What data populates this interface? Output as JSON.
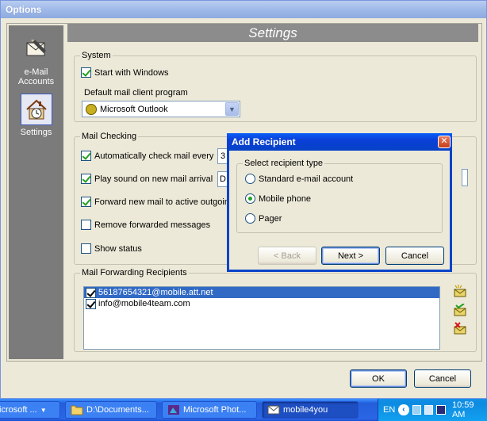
{
  "window": {
    "title": "Options"
  },
  "nav": {
    "items": [
      {
        "label_lines": [
          "e-Mail",
          "Accounts"
        ],
        "icon": "email-accounts-icon",
        "selected": false
      },
      {
        "label_lines": [
          "Settings"
        ],
        "icon": "settings-house-icon",
        "selected": true
      }
    ]
  },
  "header": {
    "title": "Settings"
  },
  "system": {
    "legend": "System",
    "start_with_windows": {
      "label": "Start with Windows",
      "checked": true
    },
    "default_mail_label": "Default mail client program",
    "mail_client": {
      "value": "Microsoft Outlook",
      "icon": "outlook-icon"
    }
  },
  "mail_checking": {
    "legend": "Mail Checking",
    "auto_check": {
      "label": "Automatically check mail every",
      "checked": true,
      "value": "3"
    },
    "play_sound": {
      "label": "Play sound on new mail arrival",
      "checked": true,
      "value": "D:"
    },
    "forward_new": {
      "label": "Forward new mail to active outgoing",
      "checked": true
    },
    "remove_forwarded": {
      "label": "Remove forwarded messages",
      "checked": false
    },
    "show_status": {
      "label": "Show status",
      "checked": false
    }
  },
  "forwarding": {
    "legend": "Mail Forwarding Recipients",
    "recipients": [
      {
        "text": "56187654321@mobile.att.net",
        "checked": true,
        "selected": true
      },
      {
        "text": "info@mobile4team.com",
        "checked": true,
        "selected": false
      }
    ],
    "side_icons": [
      "add-recipient-icon",
      "edit-recipient-icon",
      "delete-recipient-icon"
    ]
  },
  "footer": {
    "ok": "OK",
    "cancel": "Cancel"
  },
  "dialog": {
    "title": "Add Recipient",
    "legend": "Select recipient type",
    "options": [
      {
        "label": "Standard e-mail account",
        "checked": false
      },
      {
        "label": "Mobile phone",
        "checked": true
      },
      {
        "label": "Pager",
        "checked": false
      }
    ],
    "back": "< Back",
    "next": "Next >",
    "cancel": "Cancel"
  },
  "taskbar": {
    "tasks": [
      {
        "label": "icrosoft ...",
        "icon": "dropdown-arrow-icon",
        "active": false
      },
      {
        "label": "D:\\Documents...",
        "icon": "folder-icon",
        "active": false
      },
      {
        "label": "Microsoft Phot...",
        "icon": "photo-editor-icon",
        "active": false
      },
      {
        "label": "mobile4you",
        "icon": "mail-envelope-icon",
        "active": true
      }
    ],
    "language": "EN",
    "clock": "10:59 AM"
  },
  "colors": {
    "accent": "#0a44c8",
    "check": "#21a121",
    "selection": "#316ac5"
  }
}
